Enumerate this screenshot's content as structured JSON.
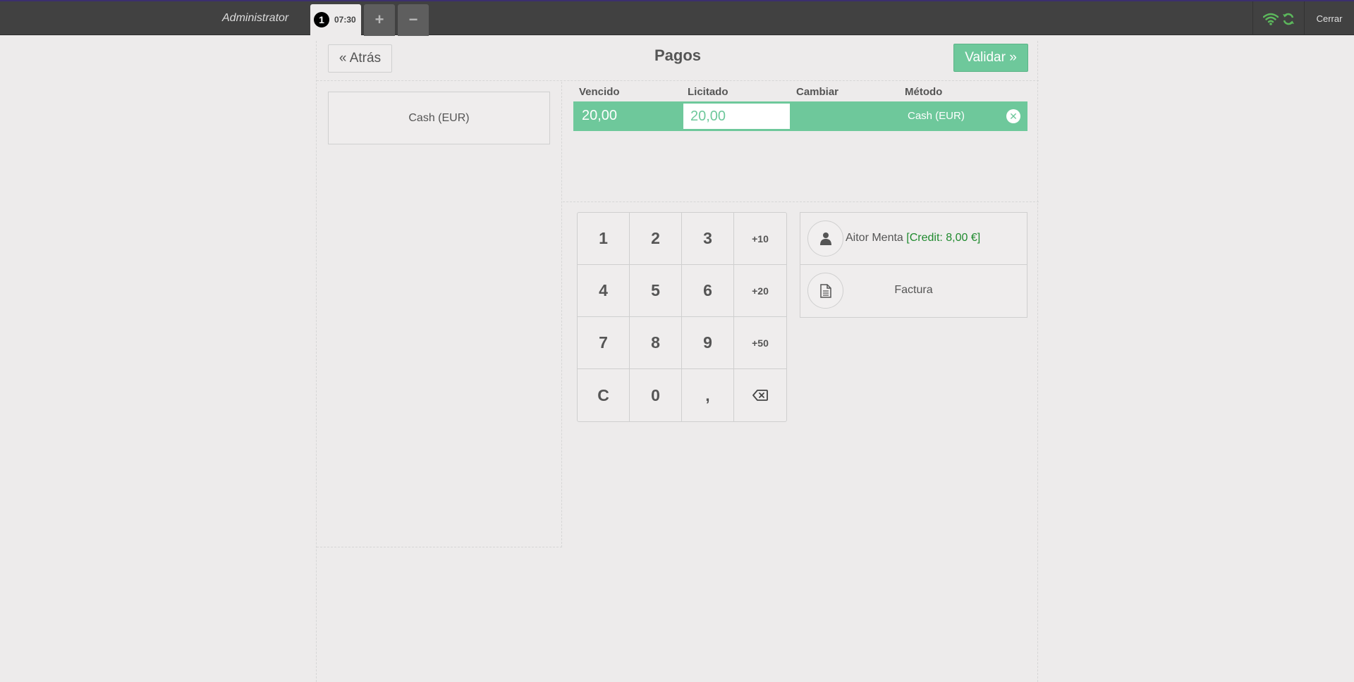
{
  "topbar": {
    "username": "Administrator",
    "order": {
      "number": "1",
      "time": "07:30"
    },
    "add_order": "+",
    "remove_order": "−",
    "close_label": "Cerrar",
    "status_color": "#5cb85c"
  },
  "header": {
    "back_label": "Atrás",
    "title": "Pagos",
    "validate_label": "Validar"
  },
  "payment_methods": [
    {
      "label": "Cash (EUR)"
    }
  ],
  "paymentlines": {
    "columns": {
      "due": "Vencido",
      "tendered": "Licitado",
      "change": "Cambiar",
      "method": "Método"
    },
    "rows": [
      {
        "due": "20,00",
        "tendered": "20,00",
        "change": "",
        "method": "Cash (EUR)"
      }
    ]
  },
  "numpad": {
    "keys": [
      "1",
      "2",
      "3",
      "+10",
      "4",
      "5",
      "6",
      "+20",
      "7",
      "8",
      "9",
      "+50",
      "C",
      "0",
      ",",
      "backspace"
    ]
  },
  "customer": {
    "name": "Aitor Menta",
    "credit": "[Credit: 8,00 €]"
  },
  "invoice": {
    "label": "Factura"
  },
  "colors": {
    "accent": "#6ec89b",
    "topbar": "#414141",
    "background": "#edebeb"
  }
}
